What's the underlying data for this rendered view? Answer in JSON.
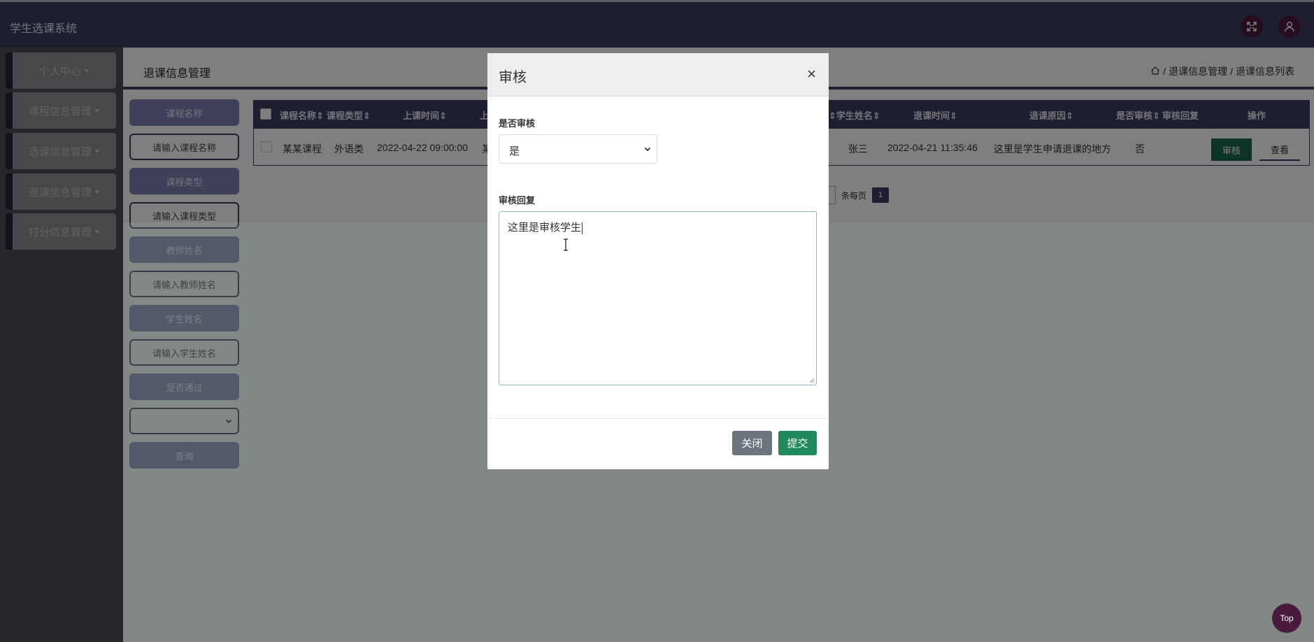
{
  "header": {
    "app_title": "学生选课系统",
    "icons": [
      "fullscreen-icon",
      "user-icon"
    ]
  },
  "sidebar": {
    "items": [
      {
        "label": "个人中心"
      },
      {
        "label": "课程信息管理"
      },
      {
        "label": "选课信息管理"
      },
      {
        "label": "退课信息管理"
      },
      {
        "label": "打分信息管理"
      }
    ]
  },
  "page": {
    "title": "退课信息管理",
    "breadcrumb": [
      "退课信息管理",
      "退课信息列表"
    ],
    "breadcrumb_sep": "/"
  },
  "filters": {
    "course_name_label": "课程名称",
    "course_name_placeholder": "请输入课程名称",
    "course_type_label": "课程类型",
    "course_type_placeholder": "请输入课程类型",
    "teacher_label": "教师姓名",
    "teacher_placeholder": "请输入教师姓名",
    "student_label": "学生姓名",
    "student_placeholder": "请输入学生姓名",
    "passed_label": "是否通过",
    "passed_value": "",
    "query_button": "查询"
  },
  "table": {
    "headers": {
      "course_name": "课程名称",
      "course_type": "课程类型",
      "class_time": "上课时间",
      "partial": "上",
      "student_name": "学生姓名",
      "drop_time": "退课时间",
      "drop_reason": "退课原因",
      "audited": "是否审核",
      "audit_reply": "审核回复",
      "actions": "操作"
    },
    "row": {
      "course_name": "某某课程",
      "course_type": "外语类",
      "class_time": "2022-04-22 09:00:00",
      "partial": "某",
      "student_name": "张三",
      "drop_time": "2022-04-21 11:35:46",
      "drop_reason": "这里是学生申请退课的地方",
      "audited": "否",
      "audit_reply": "",
      "audit_button": "审核",
      "view_button": "查看"
    }
  },
  "pagination": {
    "per_page_label": "条每页",
    "current_page": "1"
  },
  "modal": {
    "title": "审核",
    "close_symbol": "×",
    "audit_label": "是否审核",
    "audit_value": "是",
    "reply_label": "审核回复",
    "reply_value": "这里是审核学生",
    "close_button": "关闭",
    "submit_button": "提交"
  },
  "top_button": "Top",
  "colors": {
    "primary": "#3b3d5e",
    "accent_purple": "#7f82b6",
    "success": "#1f8a5b",
    "secondary": "#6c757d",
    "icon_bg": "#4a1a3e"
  }
}
